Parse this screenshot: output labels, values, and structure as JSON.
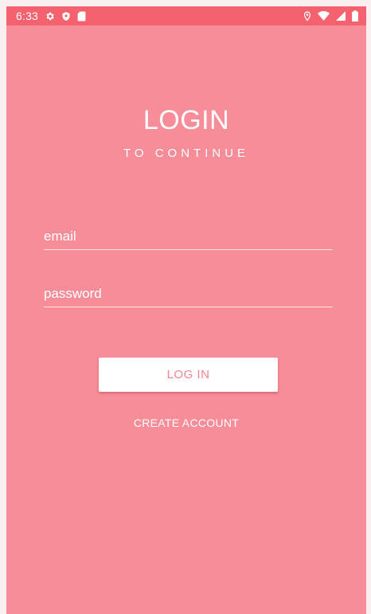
{
  "status_bar": {
    "time": "6:33",
    "icons_left": [
      "gear-icon",
      "shield-icon",
      "sd-card-icon"
    ],
    "icons_right": [
      "location-icon",
      "wifi-icon",
      "signal-icon",
      "battery-icon"
    ]
  },
  "login": {
    "title": "LOGIN",
    "subtitle": "TO CONTINUE",
    "email_placeholder": "email",
    "password_placeholder": "password",
    "login_button": "LOG IN",
    "create_account": "CREATE ACCOUNT"
  },
  "colors": {
    "background": "#f78d98",
    "status_bar": "#f4616f",
    "button_text": "#f4848f",
    "text": "#ffffff"
  }
}
